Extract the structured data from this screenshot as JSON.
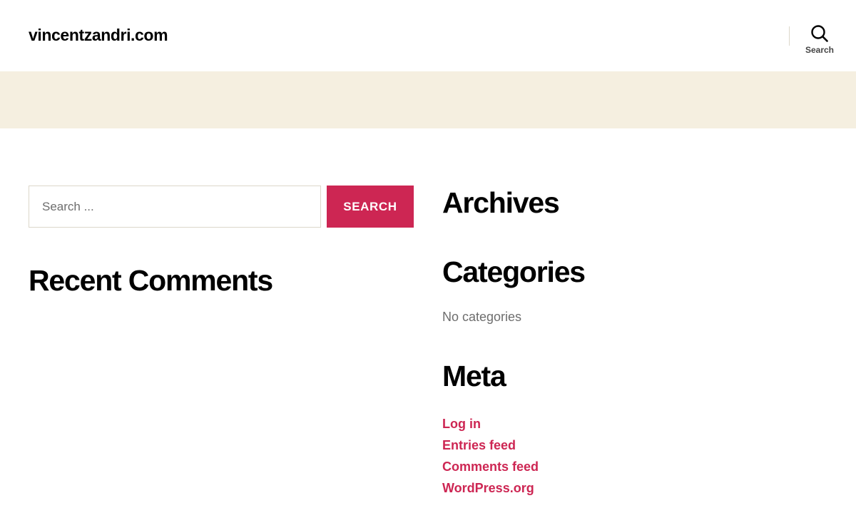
{
  "header": {
    "site_title": "vincentzandri.com",
    "search_toggle_label": "Search",
    "search_icon": "search-icon"
  },
  "colors": {
    "accent": "#cd2653",
    "band": "#f5efe0",
    "muted_text": "#6d6d6d",
    "border": "#dcd7ca"
  },
  "search_widget": {
    "placeholder": "Search ...",
    "value": "",
    "submit_label": "SEARCH"
  },
  "recent_comments": {
    "title": "Recent Comments"
  },
  "archives": {
    "title": "Archives"
  },
  "categories": {
    "title": "Categories",
    "empty_text": "No categories"
  },
  "meta": {
    "title": "Meta",
    "links": [
      {
        "label": "Log in"
      },
      {
        "label": "Entries feed"
      },
      {
        "label": "Comments feed"
      },
      {
        "label": "WordPress.org"
      }
    ]
  }
}
